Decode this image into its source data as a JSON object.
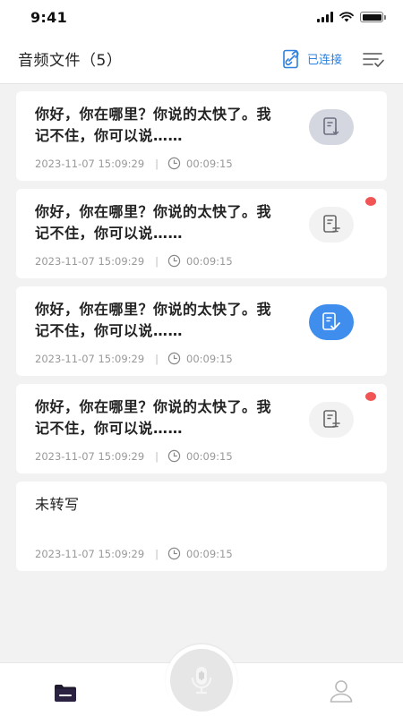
{
  "status_bar": {
    "time": "9:41"
  },
  "header": {
    "title": "音频文件（5）",
    "connect_label": "已连接",
    "accent_color": "#2d82e0"
  },
  "cards": [
    {
      "text": "你好，你在哪里？你说的太快了。我记不住，你可以说……",
      "date": "2023-11-07 15:09:29",
      "separator": "|",
      "duration": "00:09:15",
      "action_icon": "document-download-icon",
      "unread": false
    },
    {
      "text": "你好，你在哪里？你说的太快了。我记不住，你可以说……",
      "date": "2023-11-07 15:09:29",
      "separator": "|",
      "duration": "00:09:15",
      "action_icon": "document-transcribe-icon",
      "unread": true
    },
    {
      "text": "你好，你在哪里？你说的太快了。我记不住，你可以说……",
      "date": "2023-11-07 15:09:29",
      "separator": "|",
      "duration": "00:09:15",
      "action_icon": "document-check-icon",
      "unread": false
    },
    {
      "text": "你好，你在哪里？你说的太快了。我记不住，你可以说……",
      "date": "2023-11-07 15:09:29",
      "separator": "|",
      "duration": "00:09:15",
      "action_icon": "document-transcribe-icon",
      "unread": true
    },
    {
      "text": "未转写",
      "date": "2023-11-07 15:09:29",
      "separator": "|",
      "duration": "00:09:15",
      "action_icon": "",
      "unread": false
    }
  ],
  "tabbar": {
    "tabs": [
      {
        "icon": "folder-icon",
        "active": true
      },
      {
        "icon": "microphone-icon",
        "active": false
      },
      {
        "icon": "user-icon",
        "active": false
      }
    ]
  },
  "colors": {
    "unread_dot": "#f05454",
    "done_button": "#3f8ded",
    "background": "#f2f2f2"
  }
}
